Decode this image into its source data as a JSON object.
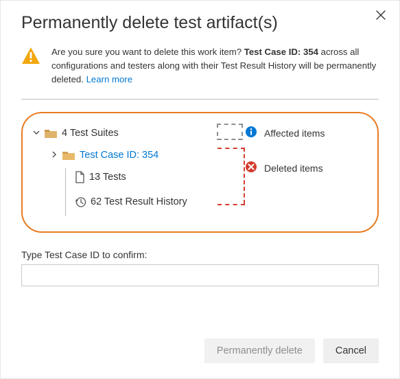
{
  "title": "Permanently delete test artifact(s)",
  "warning": {
    "prefix": "Are you sure you want to delete this work item? ",
    "bold": "Test Case ID: 354",
    "suffix": " across all configurations and testers along with their Test Result History will be permanently deleted. ",
    "learn_more": "Learn more"
  },
  "tree": {
    "root_label": "4 Test Suites",
    "case_label": "Test Case ID: 354",
    "tests_label": "13 Tests",
    "history_label": "62 Test Result History"
  },
  "legend": {
    "affected": "Affected items",
    "deleted": "Deleted items"
  },
  "confirm": {
    "label": "Type Test Case ID to confirm:",
    "value": "",
    "placeholder": ""
  },
  "buttons": {
    "primary": "Permanently delete",
    "cancel": "Cancel"
  },
  "icons": {
    "close": "close-icon",
    "warning": "warning-triangle-icon",
    "folder_solid": "folder-icon",
    "folder_open": "folder-open-icon",
    "file": "file-icon",
    "history": "history-icon",
    "info": "info-circle-icon",
    "error": "error-circle-icon",
    "chevron_down": "chevron-down-icon",
    "chevron_right": "chevron-right-icon"
  },
  "colors": {
    "link": "#0078d4",
    "warning": "#f2a60d",
    "panel_border": "#e87b22",
    "deleted": "#d43b2e"
  }
}
